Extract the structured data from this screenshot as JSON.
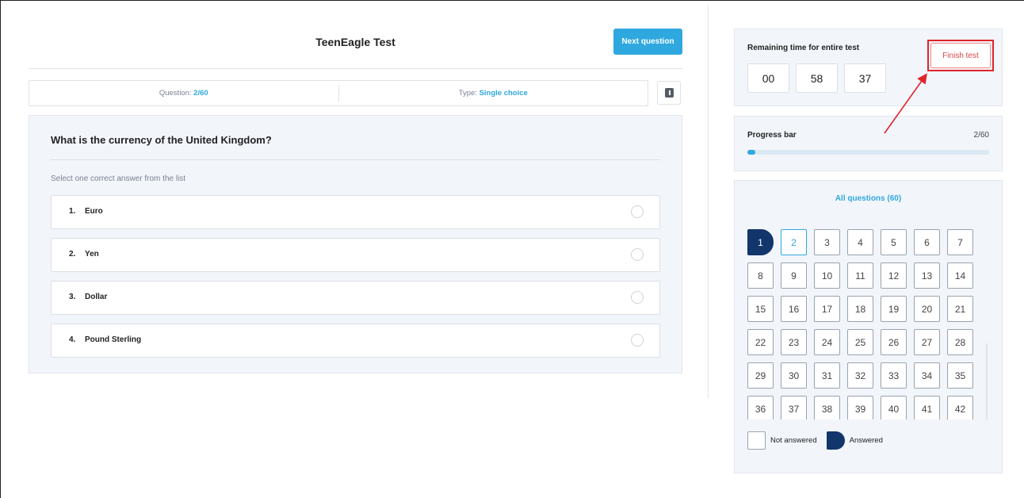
{
  "header": {
    "title": "TeenEagle Test",
    "next_label": "Next question"
  },
  "info": {
    "question_label": "Question: ",
    "question_value": "2/60",
    "type_label": "Type: ",
    "type_value": "Single choice",
    "info_icon": "book-icon"
  },
  "question": {
    "text": "What is the currency of the United Kingdom?",
    "hint": "Select one correct answer from the list",
    "options": [
      {
        "num": "1.",
        "label": "Euro"
      },
      {
        "num": "2.",
        "label": "Yen"
      },
      {
        "num": "3.",
        "label": "Dollar"
      },
      {
        "num": "4.",
        "label": "Pound Sterling"
      }
    ]
  },
  "timer": {
    "label": "Remaining time for entire test",
    "hours": "00",
    "minutes": "58",
    "seconds": "37",
    "finish_label": "Finish test"
  },
  "progress": {
    "label": "Progress bar",
    "count": "2/60",
    "fraction": 0.033
  },
  "navigator": {
    "all_label": "All questions (60)",
    "numbers": [
      "1",
      "2",
      "3",
      "4",
      "5",
      "6",
      "7",
      "8",
      "9",
      "10",
      "11",
      "12",
      "13",
      "14",
      "15",
      "16",
      "17",
      "18",
      "19",
      "20",
      "21",
      "22",
      "23",
      "24",
      "25",
      "26",
      "27",
      "28",
      "29",
      "30",
      "31",
      "32",
      "33",
      "34",
      "35",
      "36",
      "37",
      "38",
      "39",
      "40",
      "41",
      "42"
    ],
    "answered": [
      1
    ],
    "current": 2
  },
  "legend": {
    "not_answered": "Not answered",
    "answered": "Answered"
  },
  "colors": {
    "accent": "#2fa8e0",
    "answered": "#12356b",
    "highlight": "#e0252b"
  }
}
